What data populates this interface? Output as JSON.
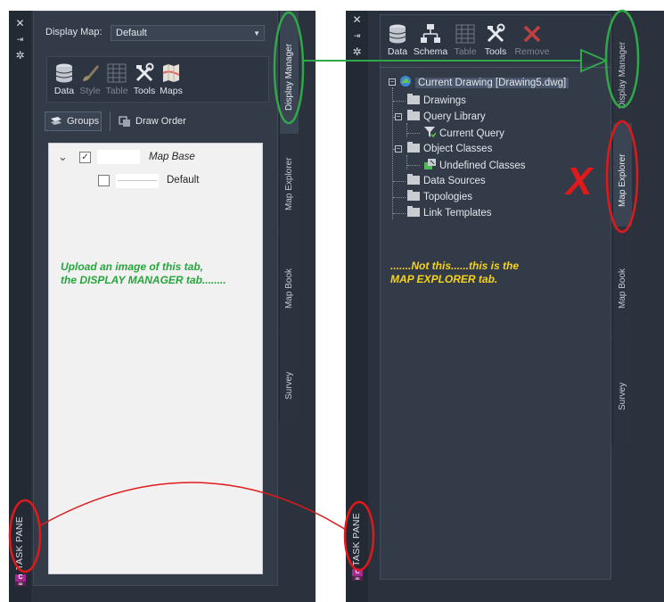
{
  "left_panel": {
    "display_map_label": "Display Map:",
    "display_map_value": "Default",
    "toolbar": [
      {
        "label": "Data",
        "icon": "data-cylinder-icon",
        "enabled": true
      },
      {
        "label": "Style",
        "icon": "brush-icon",
        "enabled": false
      },
      {
        "label": "Table",
        "icon": "table-grid-icon",
        "enabled": false
      },
      {
        "label": "Tools",
        "icon": "tools-wrench-icon",
        "enabled": true
      },
      {
        "label": "Maps",
        "icon": "folded-map-icon",
        "enabled": true
      }
    ],
    "groups_label": "Groups",
    "draw_order_label": "Draw Order",
    "layers": [
      {
        "name": "Map Base",
        "checked": true,
        "italic": true
      },
      {
        "name": "Default",
        "checked": false,
        "italic": false
      }
    ],
    "tabs": [
      "Display Manager",
      "Map Explorer",
      "Map Book",
      "Survey"
    ],
    "active_tab": "Display Manager",
    "task_pane_label": "TASK PANE",
    "annotation": {
      "line1": "Upload an image of this tab,",
      "line2": "the DISPLAY MANAGER tab........",
      "color": "#26a63c"
    }
  },
  "right_panel": {
    "toolbar": [
      {
        "label": "Data",
        "icon": "data-cylinder-icon",
        "enabled": true
      },
      {
        "label": "Schema",
        "icon": "schema-tree-icon",
        "enabled": true
      },
      {
        "label": "Table",
        "icon": "table-grid-icon",
        "enabled": false
      },
      {
        "label": "Tools",
        "icon": "tools-wrench-icon",
        "enabled": true
      },
      {
        "label": "Remove",
        "icon": "remove-x-icon",
        "enabled": false
      }
    ],
    "tree": {
      "root": "Current Drawing [Drawing5.dwg]",
      "drawings": "Drawings",
      "query_library": "Query Library",
      "current_query": "Current Query",
      "object_classes": "Object Classes",
      "undefined_classes": "Undefined Classes",
      "data_sources": "Data Sources",
      "topologies": "Topologies",
      "link_templates": "Link Templates"
    },
    "tabs": [
      "Display Manager",
      "Map Explorer",
      "Map Book",
      "Survey"
    ],
    "active_tab": "Map Explorer",
    "task_pane_label": "TASK PANE",
    "annotation": {
      "line1": ".......Not this......this is the",
      "line2": "MAP EXPLORER tab.",
      "color": "#f5d31c"
    },
    "x_mark": "X"
  },
  "colors": {
    "panel_bg": "#2b323e",
    "inner_bg": "#333b48",
    "ellipse_green": "#2fa84a",
    "ellipse_red": "#e0191b"
  }
}
